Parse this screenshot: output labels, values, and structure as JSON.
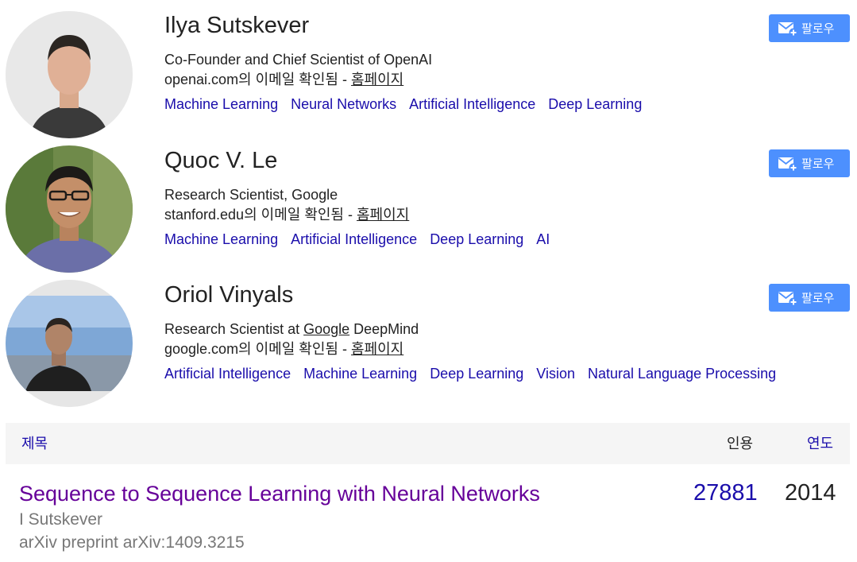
{
  "follow_label": "팔로우",
  "authors": [
    {
      "name": "Ilya Sutskever",
      "affiliation": "Co-Founder and Chief Scientist of OpenAI",
      "email_verified": "openai.com의 이메일 확인됨 - ",
      "homepage_label": "홈페이지",
      "interests": [
        "Machine Learning",
        "Neural Networks",
        "Artificial Intelligence",
        "Deep Learning"
      ]
    },
    {
      "name": "Quoc V. Le",
      "affiliation": "Research Scientist, Google",
      "email_verified": "stanford.edu의 이메일 확인됨 - ",
      "homepage_label": "홈페이지",
      "interests": [
        "Machine Learning",
        "Artificial Intelligence",
        "Deep Learning",
        "AI"
      ]
    },
    {
      "name": "Oriol Vinyals",
      "affiliation_prefix": "Research Scientist at ",
      "affiliation_link": "Google",
      "affiliation_suffix": " DeepMind",
      "email_verified": "google.com의 이메일 확인됨 - ",
      "homepage_label": "홈페이지",
      "interests": [
        "Artificial Intelligence",
        "Machine Learning",
        "Deep Learning",
        "Vision",
        "Natural Language Processing"
      ]
    }
  ],
  "table": {
    "col_title": "제목",
    "col_cites": "인용",
    "col_year": "연도"
  },
  "papers": [
    {
      "title": "Sequence to Sequence Learning with Neural Networks",
      "authors": "I Sutskever",
      "venue": "arXiv preprint arXiv:1409.3215",
      "citations": "27881",
      "year": "2014"
    }
  ],
  "colors": {
    "link": "#1a0dab",
    "visited": "#660099",
    "button": "#4d90fe",
    "header_bg": "#f5f5f5",
    "meta_text": "#777777"
  }
}
